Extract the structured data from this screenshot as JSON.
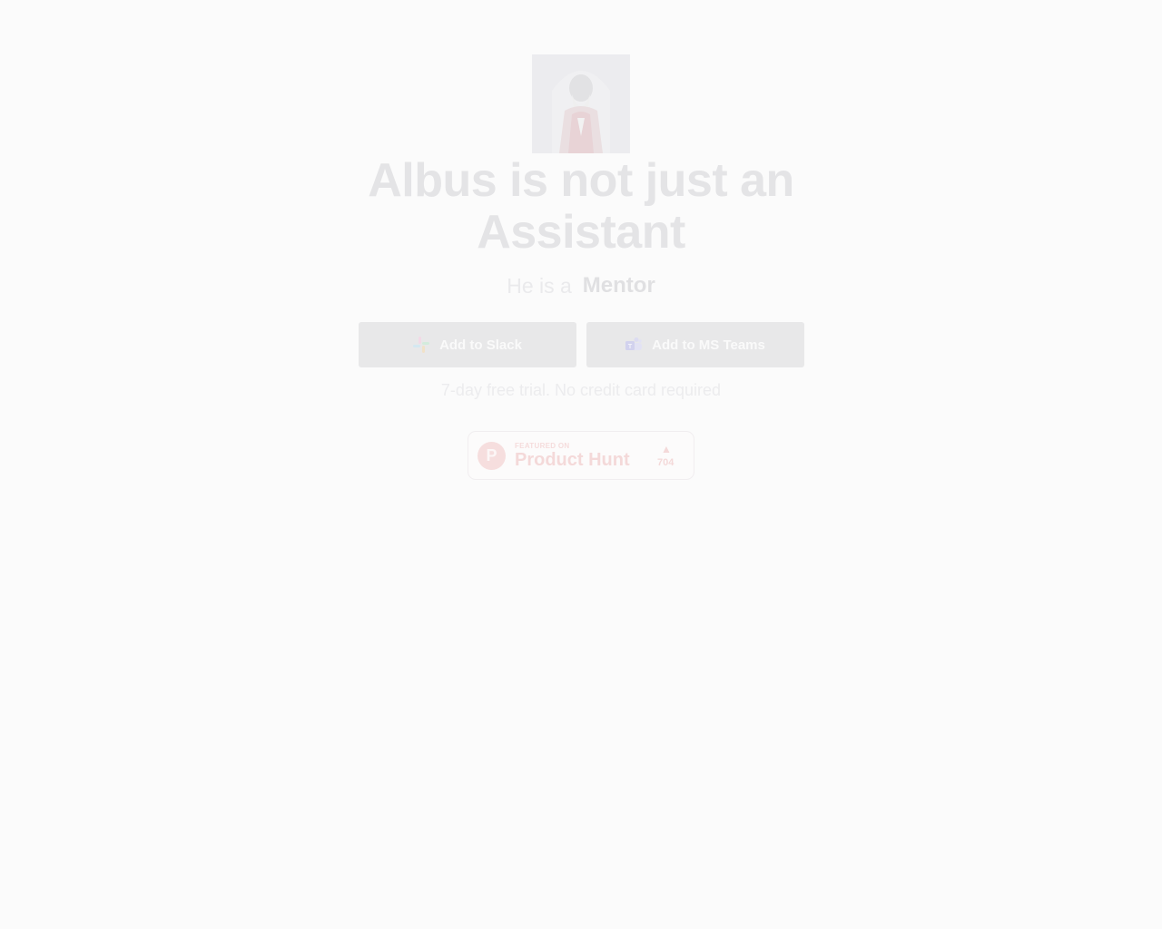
{
  "hero": {
    "portrait_alt": "Albus",
    "headline_line1": "Albus is not just an",
    "headline_line2": "Assistant",
    "tagline_prefix": "He is a",
    "tagline_role": "Mentor"
  },
  "actions": {
    "slack_label": "Add to Slack",
    "slack_icon": "slack-icon",
    "teams_label": "Add to MS Teams",
    "teams_icon": "ms-teams-icon"
  },
  "trial_note": "7-day free trial. No credit card required",
  "product_hunt": {
    "featured_label": "FEATURED ON",
    "name": "Product Hunt",
    "upvote_count": "704",
    "logo_letter": "P"
  },
  "colors": {
    "background": "#fbfbfb",
    "button_bg": "#e8e8e9",
    "product_hunt_accent": "#f4d9d9"
  }
}
